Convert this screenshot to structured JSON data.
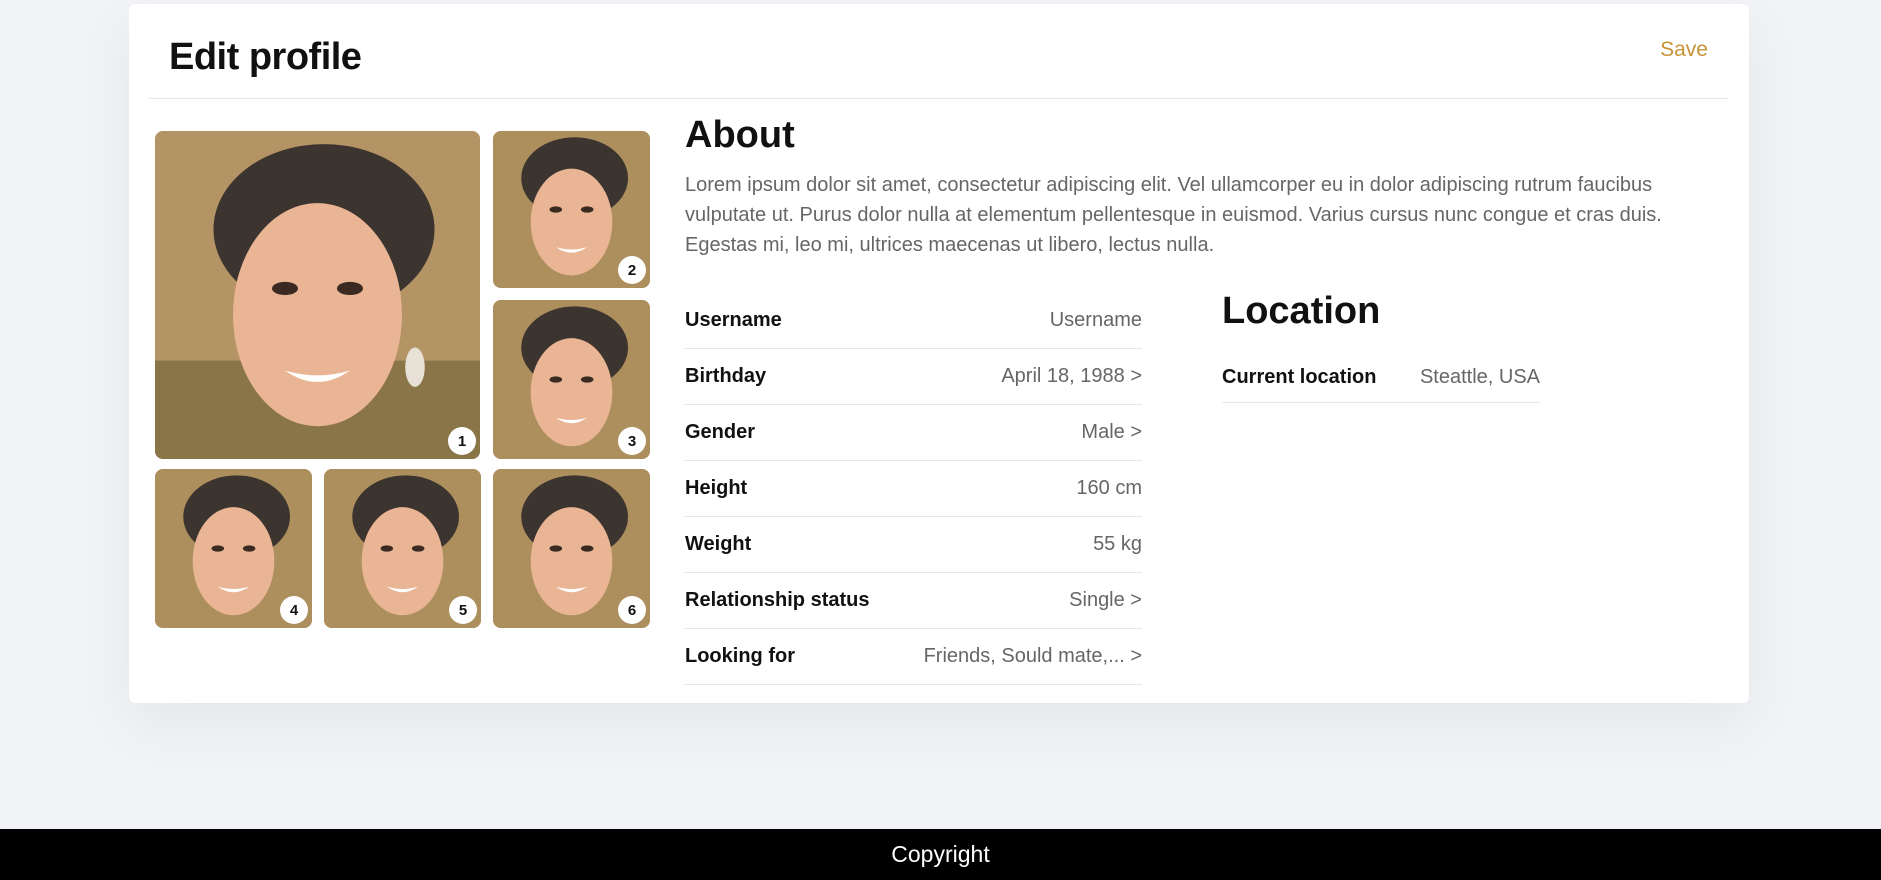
{
  "header": {
    "title": "Edit profile",
    "save_label": "Save"
  },
  "photos": [
    {
      "number": "1"
    },
    {
      "number": "2"
    },
    {
      "number": "3"
    },
    {
      "number": "4"
    },
    {
      "number": "5"
    },
    {
      "number": "6"
    }
  ],
  "about": {
    "title": "About",
    "text": "Lorem ipsum dolor sit amet, consectetur adipiscing elit. Vel ullamcorper eu in dolor adipiscing rutrum faucibus vulputate ut. Purus dolor nulla at elementum pellentesque in euismod. Varius cursus nunc congue et cras duis. Egestas mi, leo mi, ultrices maecenas ut libero, lectus nulla."
  },
  "details": [
    {
      "label": "Username",
      "value": "Username"
    },
    {
      "label": "Birthday",
      "value": "April 18, 1988 >"
    },
    {
      "label": "Gender",
      "value": "Male >"
    },
    {
      "label": "Height",
      "value": "160 cm"
    },
    {
      "label": "Weight",
      "value": "55 kg"
    },
    {
      "label": "Relationship status",
      "value": "Single >"
    },
    {
      "label": "Looking for",
      "value": "Friends, Sould mate,... >"
    }
  ],
  "location": {
    "title": "Location",
    "current_label": "Current location",
    "current_value": "Steattle, USA"
  },
  "footer": {
    "text": "Copyright"
  },
  "colors": {
    "accent": "#c79236",
    "background": "#f2f3f6",
    "footer": "#000000"
  }
}
